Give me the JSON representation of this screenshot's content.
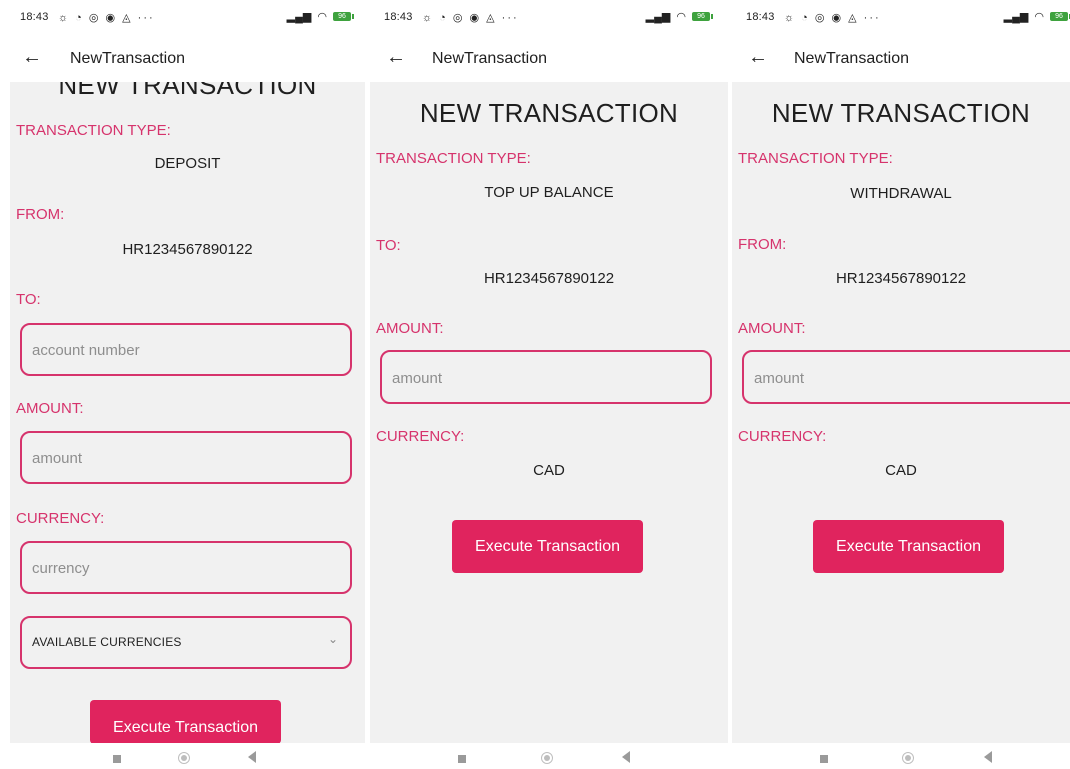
{
  "status": {
    "time": "18:43",
    "icons_left": "☼ ◔ ◎ ◉ ◬",
    "more": "···",
    "signal": "📶",
    "wifi": "≋",
    "battery": "96"
  },
  "app": {
    "title": "NewTransaction",
    "back_icon": "arrow-left-icon"
  },
  "screens": [
    {
      "heading": "NEW TRANSACTION",
      "type_label": "TRANSACTION TYPE:",
      "type_value": "DEPOSIT",
      "from_label": "FROM:",
      "from_value": "HR1234567890122",
      "to_label": "TO:",
      "to_placeholder": "account number",
      "amount_label": "AMOUNT:",
      "amount_placeholder": "amount",
      "currency_label": "CURRENCY:",
      "currency_placeholder": "currency",
      "currencies_select": "AVAILABLE CURRENCIES",
      "button": "Execute Transaction"
    },
    {
      "heading": "NEW TRANSACTION",
      "type_label": "TRANSACTION TYPE:",
      "type_value": "TOP UP BALANCE",
      "to_label": "TO:",
      "to_value": "HR1234567890122",
      "amount_label": "AMOUNT:",
      "amount_placeholder": "amount",
      "currency_label": "CURRENCY:",
      "currency_value": "CAD",
      "button": "Execute Transaction"
    },
    {
      "heading": "NEW TRANSACTION",
      "type_label": "TRANSACTION TYPE:",
      "type_value": "WITHDRAWAL",
      "from_label": "FROM:",
      "from_value": "HR1234567890122",
      "amount_label": "AMOUNT:",
      "amount_placeholder": "amount",
      "currency_label": "CURRENCY:",
      "currency_value": "CAD",
      "button": "Execute Transaction"
    }
  ],
  "colors": {
    "accent": "#d6336c",
    "button": "#e0245e",
    "background": "#f1f1f1"
  }
}
